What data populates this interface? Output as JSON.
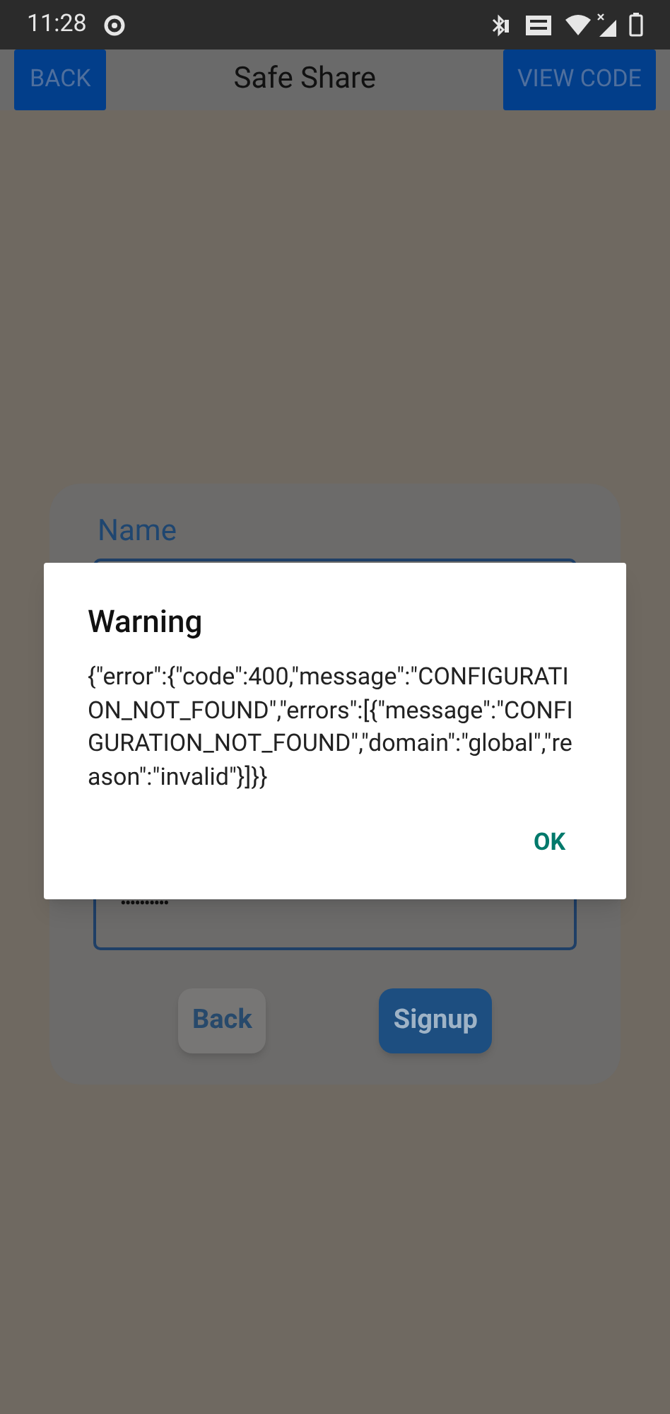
{
  "status_bar": {
    "time": "11:28"
  },
  "app_bar": {
    "back": "BACK",
    "title": "Safe Share",
    "view_code": "VIEW CODE"
  },
  "form": {
    "name_label": "Name",
    "password_value": "••••••••••",
    "buttons": [
      {
        "label": "Back",
        "kind": "secondary"
      },
      {
        "label": "Signup",
        "kind": "primary"
      }
    ]
  },
  "dialog": {
    "title": "Warning",
    "message": "{\"error\":{\"code\":400,\"message\":\"CONFIGURATION_NOT_FOUND\",\"errors\":[{\"message\":\"CONFIGURATION_NOT_FOUND\",\"domain\":\"global\",\"reason\":\"invalid\"}]}}",
    "button": "OK"
  }
}
